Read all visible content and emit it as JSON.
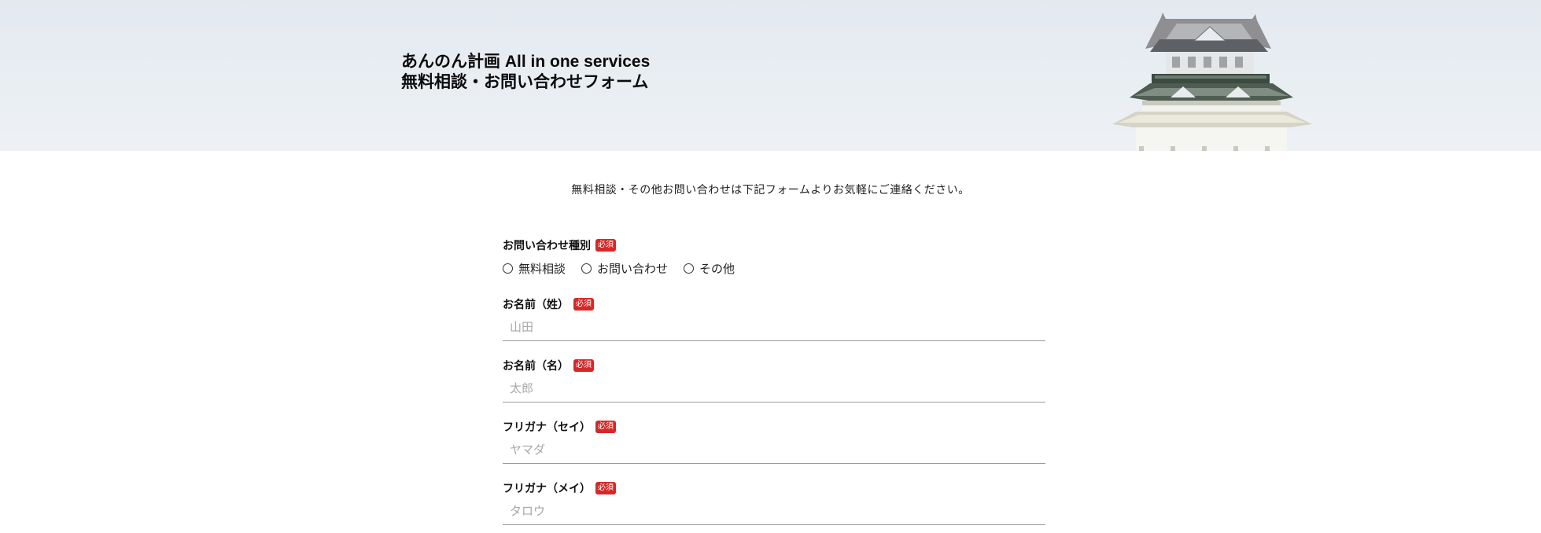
{
  "header": {
    "title_line1": "あんのん計画 All in one services",
    "title_line2": "無料相談・お問い合わせフォーム"
  },
  "intro_text": "無料相談・その他お問い合わせは下記フォームよりお気軽にご連絡ください。",
  "required_badge": "必須",
  "form": {
    "inquiry_type": {
      "label": "お問い合わせ種別",
      "options": [
        "無料相談",
        "お問い合わせ",
        "その他"
      ]
    },
    "last_name": {
      "label": "お名前（姓）",
      "placeholder": "山田",
      "value": ""
    },
    "first_name": {
      "label": "お名前（名）",
      "placeholder": "太郎",
      "value": ""
    },
    "last_name_kana": {
      "label": "フリガナ（セイ）",
      "placeholder": "ヤマダ",
      "value": ""
    },
    "first_name_kana": {
      "label": "フリガナ（メイ）",
      "placeholder": "タロウ",
      "value": ""
    }
  },
  "colors": {
    "required_badge_bg": "#d62828",
    "field_underline": "#9a9a9a",
    "placeholder": "#a8a8a8"
  }
}
